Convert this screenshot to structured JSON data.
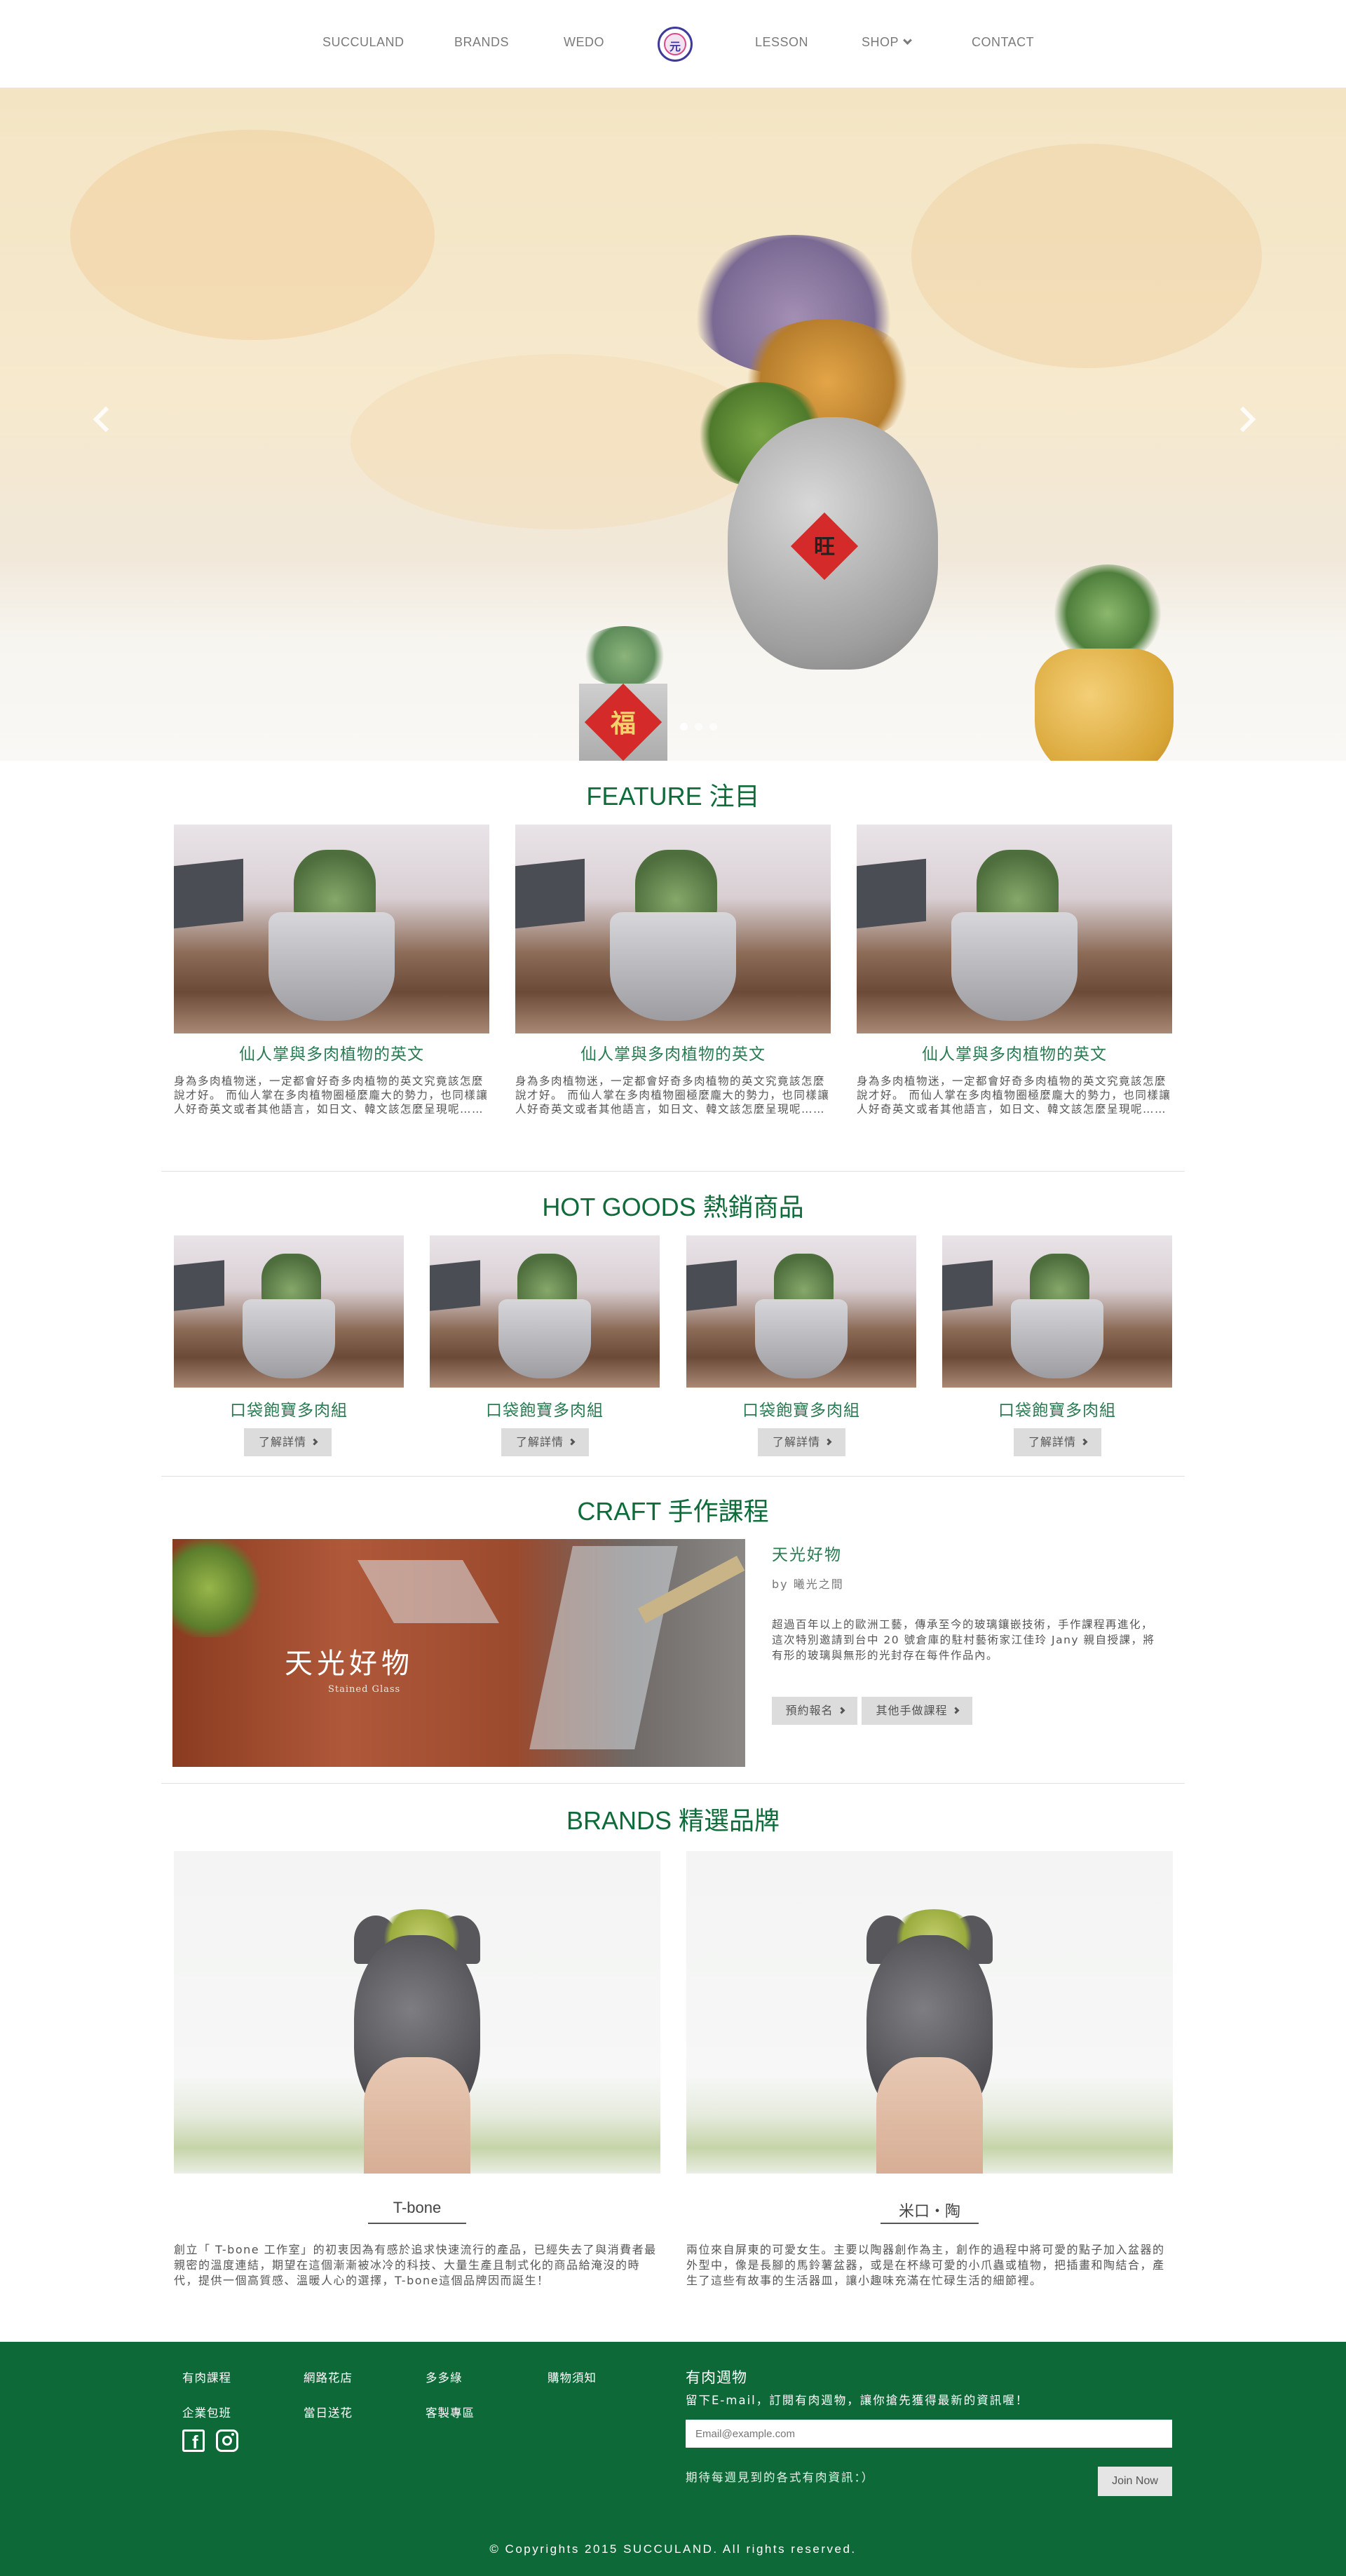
{
  "nav": {
    "items": [
      "SUCCULAND",
      "BRANDS",
      "WEDO",
      "LESSON",
      "SHOP",
      "CONTACT"
    ],
    "logo_glyph": "元"
  },
  "hero": {
    "slide_count": 3,
    "active_slide": 1,
    "pot_tags": [
      "福",
      "旺"
    ]
  },
  "feature": {
    "title": "FEATURE 注目",
    "cards": [
      {
        "title": "仙人掌與多肉植物的英文",
        "text": "身為多肉植物迷，一定都會好奇多肉植物的英文究竟該怎麼說才好。 而仙人掌在多肉植物圈極麼龐大的勢力，也同樣讓人好奇英文或者其他語言，如日文、韓文該怎麼呈現呢……"
      },
      {
        "title": "仙人掌與多肉植物的英文",
        "text": "身為多肉植物迷，一定都會好奇多肉植物的英文究竟該怎麼說才好。 而仙人掌在多肉植物圈極麼龐大的勢力，也同樣讓人好奇英文或者其他語言，如日文、韓文該怎麼呈現呢……"
      },
      {
        "title": "仙人掌與多肉植物的英文",
        "text": "身為多肉植物迷，一定都會好奇多肉植物的英文究竟該怎麼說才好。 而仙人掌在多肉植物圈極麼龐大的勢力，也同樣讓人好奇英文或者其他語言，如日文、韓文該怎麼呈現呢……"
      }
    ]
  },
  "hot": {
    "title": "HOT GOODS 熱銷商品",
    "items": [
      {
        "name": "口袋飽寶多肉組",
        "button": "了解詳情"
      },
      {
        "name": "口袋飽寶多肉組",
        "button": "了解詳情"
      },
      {
        "name": "口袋飽寶多肉組",
        "button": "了解詳情"
      },
      {
        "name": "口袋飽寶多肉組",
        "button": "了解詳情"
      }
    ]
  },
  "craft": {
    "title": "CRAFT 手作課程",
    "image_title": "天光好物",
    "image_sub": "Stained Glass",
    "course_title": "天光好物",
    "by": "by 曦光之間",
    "text": "超過百年以上的歐洲工藝，傳承至今的玻璃鑲嵌技術，手作課程再進化，這次特別邀請到台中 20 號倉庫的駐村藝術家江佳玲 Jany 親自授課，將有形的玻璃與無形的光封存在每件作品內。",
    "btn_book": "預約報名",
    "btn_other": "其他手做課程"
  },
  "brands": {
    "title": "BRANDS 精選品牌",
    "items": [
      {
        "name": "T-bone",
        "text": "創立「 T-bone 工作室」的初衷因為有感於追求快速流行的產品，已經失去了與消費者最親密的溫度連結，期望在這個漸漸被冰冷的科技、大量生產且制式化的商品給淹沒的時代，提供一個高質感、溫暖人心的選擇，T-bone這個品牌因而誕生！"
      },
      {
        "name": "米口・陶",
        "text": "兩位來自屏東的可愛女生。主要以陶器創作為主，創作的過程中將可愛的點子加入盆器的外型中，像是長腳的馬鈴薯盆器，或是在杯緣可愛的小爪蟲或植物，把插畫和陶結合，產生了這些有故事的生活器皿，讓小趣味充滿在忙碌生活的細節裡。"
      }
    ]
  },
  "footer": {
    "links": [
      "有肉課程",
      "網路花店",
      "多多綠",
      "購物須知",
      "企業包班",
      "當日送花",
      "客製專區"
    ],
    "newsletter_title": "有肉週物",
    "newsletter_desc": "留下E-mail，訂閱有肉週物，讓你搶先獲得最新的資訊喔！",
    "email_placeholder": "Email@example.com",
    "note": "期待每週見到的各式有肉資訊：）",
    "join_button": "Join Now",
    "copyright": "© Copyrights 2015 SUCCULAND. All rights reserved."
  },
  "colors": {
    "brand_green": "#0e6b3a",
    "footer_bg": "#0d6a38",
    "button_bg": "#dcdcdc"
  },
  "icons": [
    "logo-icon",
    "chevron-down-icon",
    "chevron-left-icon",
    "chevron-right-icon",
    "facebook-icon",
    "instagram-icon"
  ]
}
